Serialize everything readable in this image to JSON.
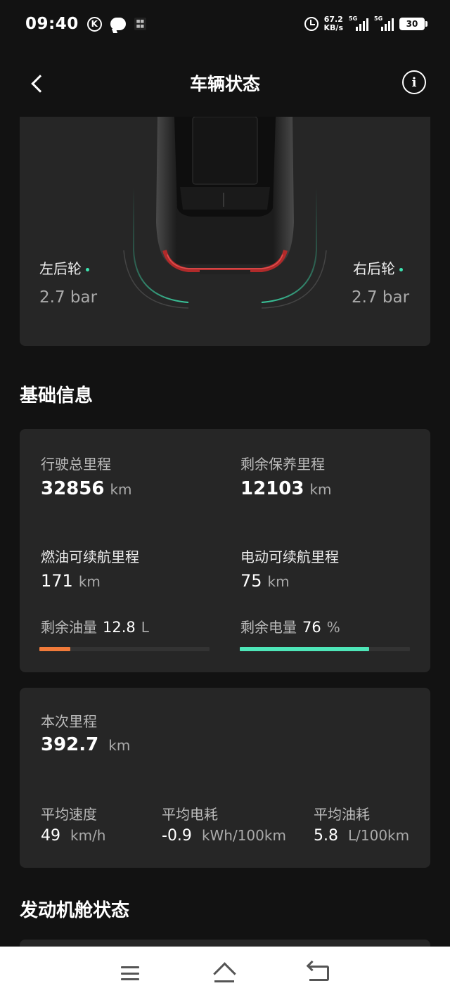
{
  "status_bar": {
    "time": "09:40",
    "k_badge": "K",
    "net_speed_value": "67.2",
    "net_speed_unit": "KB/s",
    "signal1_tag": "5G",
    "signal2_tag": "5G",
    "battery": "30"
  },
  "nav": {
    "title": "车辆状态",
    "info_glyph": "i"
  },
  "tires": {
    "rear_left": {
      "label": "左后轮",
      "value": "2.7 bar"
    },
    "rear_right": {
      "label": "右后轮",
      "value": "2.7 bar"
    },
    "status_color": "#3de3b0"
  },
  "basic_info": {
    "title": "基础信息",
    "total_mileage": {
      "label": "行驶总里程",
      "value": "32856",
      "unit": "km"
    },
    "maintenance_mileage": {
      "label": "剩余保养里程",
      "value": "12103",
      "unit": "km"
    },
    "fuel_range": {
      "label": "燃油可续航里程",
      "value": "171",
      "unit": "km"
    },
    "electric_range": {
      "label": "电动可续航里程",
      "value": "75",
      "unit": "km"
    },
    "fuel_remaining": {
      "label": "剩余油量",
      "value": "12.8",
      "unit": "L",
      "fill_fraction": 0.18,
      "color": "#f07a3a"
    },
    "battery_remaining": {
      "label": "剩余电量",
      "value": "76",
      "unit": "%",
      "fill_fraction": 0.76,
      "color": "#4ee6b8"
    }
  },
  "trip": {
    "label": "本次里程",
    "value": "392.7",
    "unit": "km",
    "avg_speed": {
      "label": "平均速度",
      "value": "49",
      "unit": "km/h"
    },
    "avg_power": {
      "label": "平均电耗",
      "value": "-0.9",
      "unit": "kWh/100km"
    },
    "avg_fuel": {
      "label": "平均油耗",
      "value": "5.8",
      "unit": "L/100km"
    }
  },
  "engine": {
    "title": "发动机舱状态"
  }
}
